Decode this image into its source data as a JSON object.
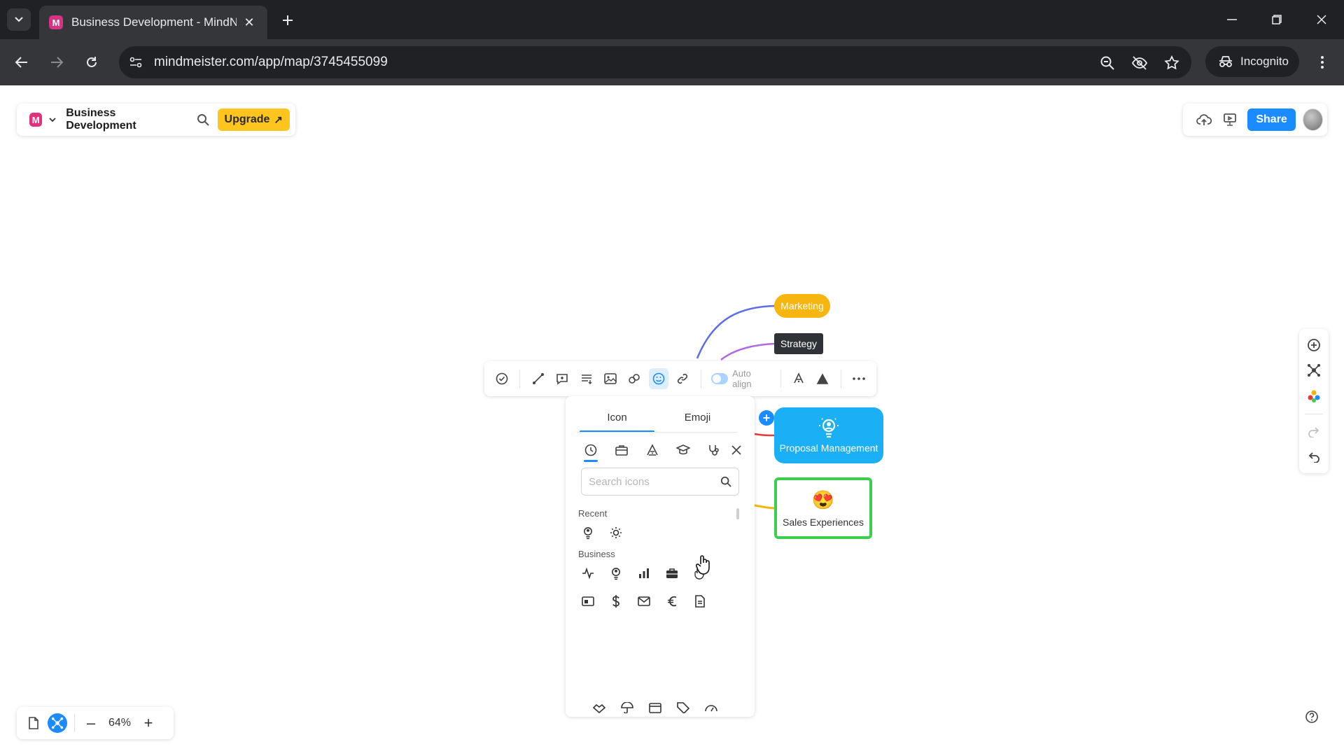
{
  "browser": {
    "tab_title": "Business Development - MindN",
    "url": "mindmeister.com/app/map/3745455099",
    "incognito_label": "Incognito",
    "favicon_letter": "M"
  },
  "app": {
    "logo_letter": "M",
    "map_title": "Business Development",
    "upgrade_label": "Upgrade",
    "share_label": "Share",
    "zoom_level": "64%"
  },
  "node_toolbar": {
    "auto_align_label": "Auto align",
    "auto_align_enabled": true
  },
  "nodes": {
    "marketing": "Marketing",
    "strategy": "Strategy",
    "proposal": "Proposal Management",
    "sales": "Sales Experiences",
    "sales_emoji": "😍"
  },
  "picker": {
    "tabs": [
      "Icon",
      "Emoji"
    ],
    "active_tab": "Icon",
    "search_placeholder": "Search icons",
    "recent_title": "Recent",
    "business_title": "Business"
  },
  "colors": {
    "accent": "#1a8cff",
    "upgrade": "#ffc51f",
    "marketing": "#f7b50f",
    "strategy": "#2f3337",
    "proposal": "#1bb0f6",
    "sales_border": "#3ccf4e"
  }
}
